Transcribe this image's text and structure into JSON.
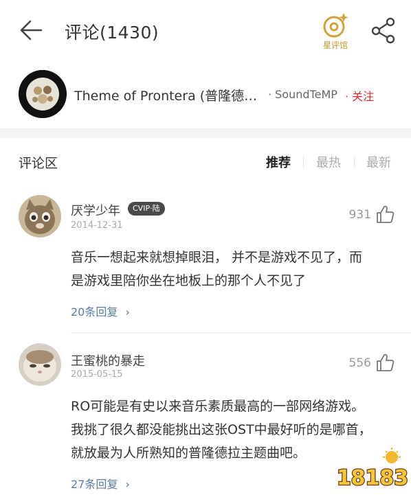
{
  "header": {
    "title": "评论(1430)",
    "star_hall_label": "星评馆"
  },
  "song": {
    "title": "Theme of Prontera (普隆德…",
    "artist": "· SoundTeMP",
    "follow_label": "· 关注"
  },
  "comment_area": {
    "title": "评论区",
    "sort_tabs": [
      "推荐",
      "最热",
      "最新"
    ],
    "active_tab": "推荐"
  },
  "comments": [
    {
      "username": "厌学少年",
      "badge": "CVIP·陆",
      "date": "2014-12-31",
      "likes": "931",
      "text_lines": [
        "音乐一想起来就想掉眼泪， 并不是游戏不见了，而",
        "是游戏里陪你坐在地板上的那个人不见了"
      ],
      "replies": "20条回复"
    },
    {
      "username": "王蜜桃的暴走",
      "date": "2015-05-15",
      "likes": "556",
      "text_lines": [
        "RO可能是有史以来音乐素质最高的一部网络游戏。",
        "我挑了很久都没能挑出这张OST中最好听的是哪首，",
        "就放最为人所熟知的普隆德拉主题曲吧。"
      ],
      "replies": "27条回复"
    }
  ],
  "watermark": {
    "text": "18183"
  },
  "colors": {
    "accent_red": "#e0262d",
    "link_blue": "#5b7aa8",
    "gold": "#c9972c"
  }
}
